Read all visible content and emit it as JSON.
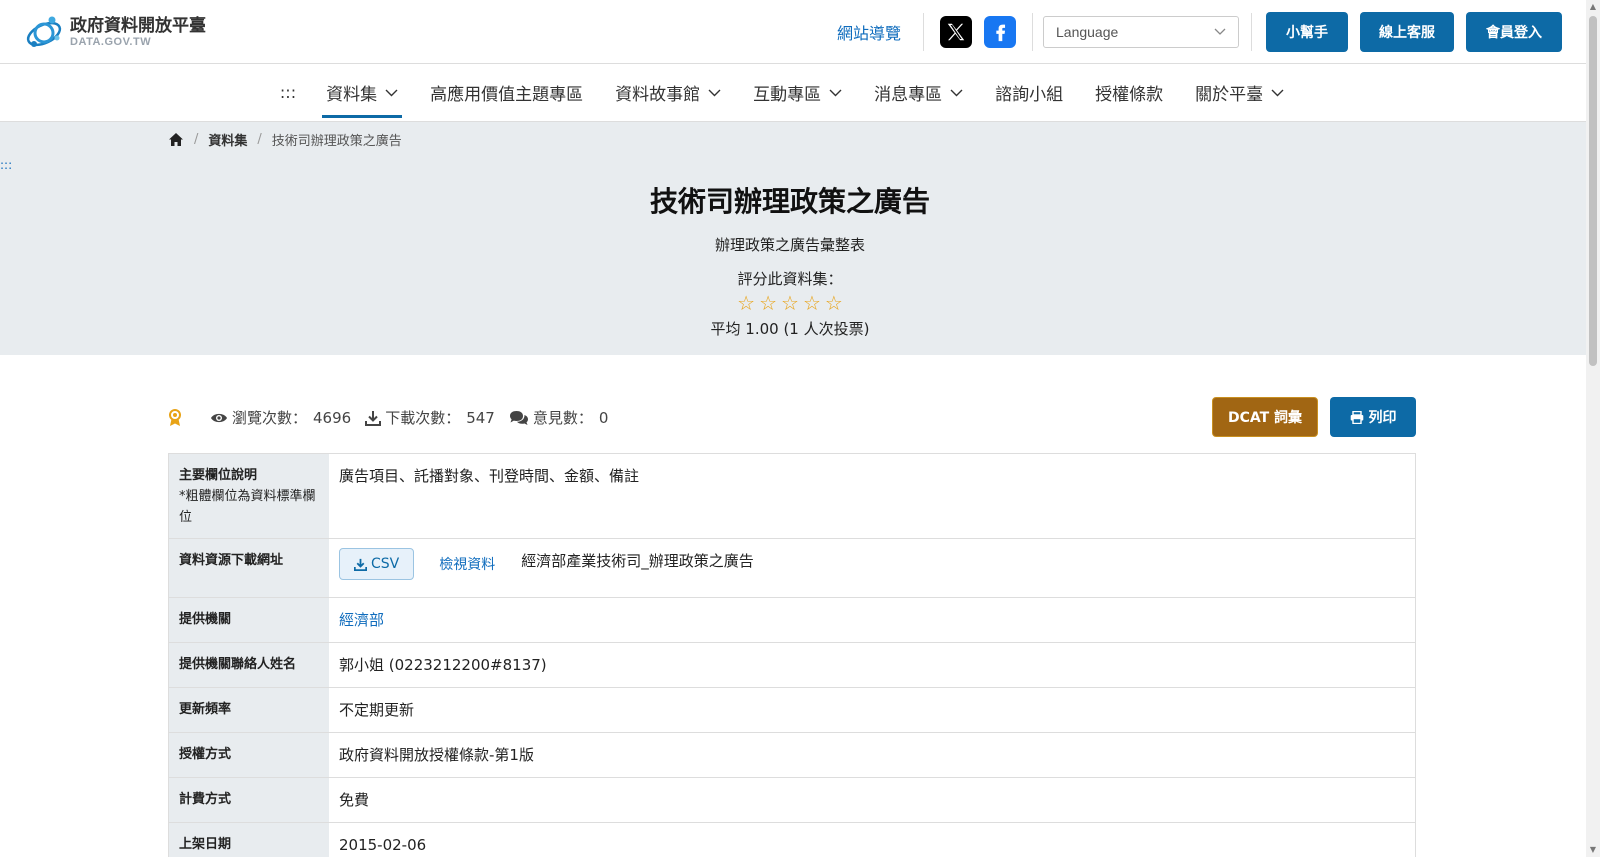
{
  "header": {
    "logo_title": "政府資料開放平臺",
    "logo_sub": "DATA.GOV.TW",
    "sitemap": "網站導覽",
    "language_placeholder": "Language",
    "buttons": [
      "小幫手",
      "線上客服",
      "會員登入"
    ]
  },
  "nav": {
    "dots": ":::",
    "items": [
      {
        "label": "資料集",
        "dropdown": true,
        "active": true
      },
      {
        "label": "高應用價值主題專區",
        "dropdown": false
      },
      {
        "label": "資料故事館",
        "dropdown": true
      },
      {
        "label": "互動專區",
        "dropdown": true
      },
      {
        "label": "消息專區",
        "dropdown": true
      },
      {
        "label": "諮詢小組",
        "dropdown": false
      },
      {
        "label": "授權條款",
        "dropdown": false
      },
      {
        "label": "關於平臺",
        "dropdown": true
      }
    ]
  },
  "breadcrumb": {
    "level1": "資料集",
    "current": "技術司辦理政策之廣告"
  },
  "side_dots": ":::",
  "dataset": {
    "title": "技術司辦理政策之廣告",
    "subtitle": "辦理政策之廣告彙整表",
    "rate_label": "評分此資料集：",
    "stars_total": 5,
    "rating_text": "平均 1.00 (1 人次投票)"
  },
  "stats": {
    "views_label": "瀏覽次數：",
    "views": "4696",
    "downloads_label": "下載次數：",
    "downloads": "547",
    "comments_label": "意見數：",
    "comments": "0"
  },
  "actions": {
    "dcat": "DCAT 詞彙",
    "print": "列印"
  },
  "table": {
    "fields_key": "主要欄位說明",
    "fields_note": "*粗體欄位為資料標準欄位",
    "fields_value": "廣告項目、託播對象、刊登時間、金額、備註",
    "resource_key": "資料資源下載網址",
    "csv_label": "CSV",
    "view_label": "檢視資料",
    "resource_name": "經濟部產業技術司_辦理政策之廣告",
    "agency_key": "提供機關",
    "agency_value": "經濟部",
    "contact_key": "提供機關聯絡人姓名",
    "contact_value": "郭小姐 (0223212200#8137)",
    "freq_key": "更新頻率",
    "freq_value": "不定期更新",
    "license_key": "授權方式",
    "license_value": "政府資料開放授權條款-第1版",
    "fee_key": "計費方式",
    "fee_value": "免費",
    "date_key": "上架日期",
    "date_value": "2015-02-06"
  },
  "colors": {
    "primary": "#0d6aa6",
    "dcat": "#a16613",
    "hero_bg": "#e8ecef",
    "star": "#e8a317"
  }
}
